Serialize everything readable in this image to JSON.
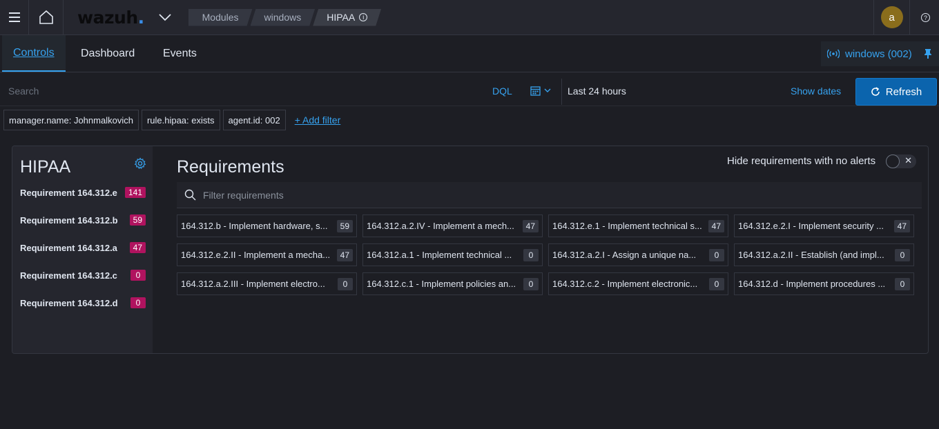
{
  "header": {
    "logo_text": "wazuh",
    "logo_dot": ".",
    "breadcrumbs": [
      "Modules",
      "windows",
      "HIPAA"
    ],
    "avatar_letter": "a",
    "help_glyph": "?",
    "info_glyph": "i"
  },
  "tabs": [
    "Controls",
    "Dashboard",
    "Events"
  ],
  "agent_pill": {
    "label": "windows (002)"
  },
  "search": {
    "placeholder": "Search",
    "dql_label": "DQL",
    "time_range": "Last 24 hours",
    "show_dates_label": "Show dates",
    "refresh_label": "Refresh"
  },
  "filters": [
    "manager.name: Johnmalkovich",
    "rule.hipaa: exists",
    "agent.id: 002"
  ],
  "add_filter_label": "+ Add filter",
  "sidebar": {
    "title": "HIPAA",
    "items": [
      {
        "label": "Requirement 164.312.e",
        "count": "141"
      },
      {
        "label": "Requirement 164.312.b",
        "count": "59"
      },
      {
        "label": "Requirement 164.312.a",
        "count": "47"
      },
      {
        "label": "Requirement 164.312.c",
        "count": "0"
      },
      {
        "label": "Requirement 164.312.d",
        "count": "0"
      }
    ]
  },
  "requirements": {
    "title": "Requirements",
    "hide_label": "Hide requirements with no alerts",
    "filter_placeholder": "Filter requirements",
    "cards": [
      {
        "label": "164.312.b - Implement hardware, s...",
        "count": "59"
      },
      {
        "label": "164.312.a.2.IV - Implement a mech...",
        "count": "47"
      },
      {
        "label": "164.312.e.1 - Implement technical s...",
        "count": "47"
      },
      {
        "label": "164.312.e.2.I - Implement security ...",
        "count": "47"
      },
      {
        "label": "164.312.e.2.II - Implement a mecha...",
        "count": "47"
      },
      {
        "label": "164.312.a.1 - Implement technical ...",
        "count": "0"
      },
      {
        "label": "164.312.a.2.I - Assign a unique na...",
        "count": "0"
      },
      {
        "label": "164.312.a.2.II - Establish (and impl...",
        "count": "0"
      },
      {
        "label": "164.312.a.2.III - Implement electro...",
        "count": "0"
      },
      {
        "label": "164.312.c.1 - Implement policies an...",
        "count": "0"
      },
      {
        "label": "164.312.c.2 - Implement electronic...",
        "count": "0"
      },
      {
        "label": "164.312.d - Implement procedures ...",
        "count": "0"
      }
    ]
  },
  "colors": {
    "accent": "#36a2ef",
    "badge_alert": "#b0135f",
    "refresh_bg": "#0b64ad"
  },
  "icons": [
    "menu-icon",
    "home-icon",
    "chevron-down-icon",
    "info-icon",
    "help-icon",
    "antenna-icon",
    "pin-icon",
    "calendar-icon",
    "refresh-icon",
    "gear-icon",
    "search-icon",
    "close-icon"
  ]
}
